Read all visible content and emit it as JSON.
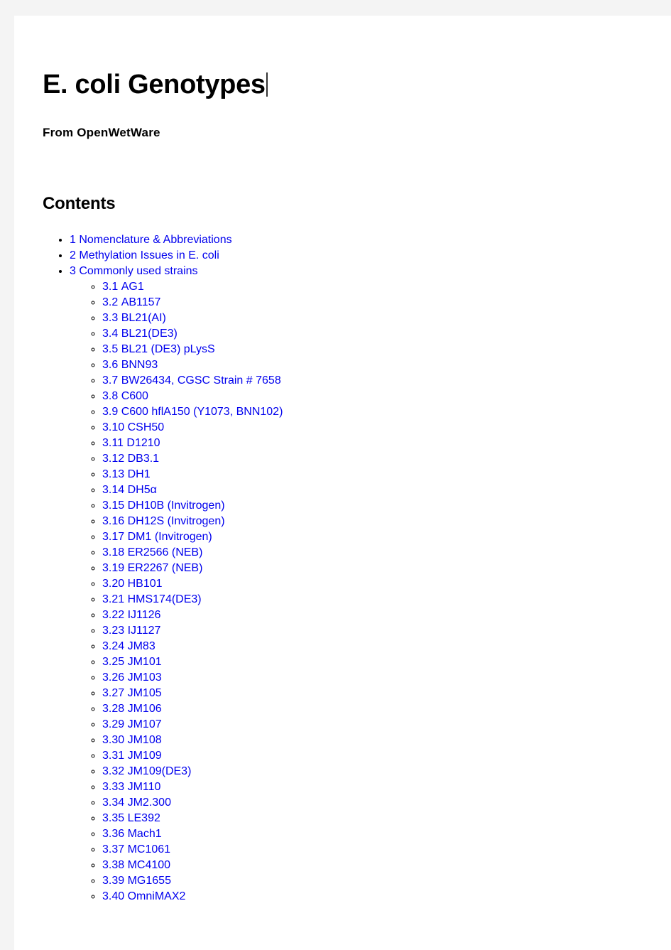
{
  "page": {
    "title": "E. coli Genotypes",
    "source_line": "From  OpenWetWare",
    "contents_heading": "Contents",
    "link_color": "#0000ee",
    "text_color": "#000000",
    "background_color": "#ffffff",
    "chrome_color": "#f4f4f4"
  },
  "toc": [
    {
      "number": "1",
      "label": "Nomenclature  &  Abbreviations",
      "children": []
    },
    {
      "number": "2",
      "label": "Methylation  Issues  in  E.  coli",
      "children": []
    },
    {
      "number": "3",
      "label": "Commonly  used  strains",
      "children": [
        {
          "number": "3.1",
          "label": "AG1"
        },
        {
          "number": "3.2",
          "label": "AB1157"
        },
        {
          "number": "3.3",
          "label": "BL21(AI)"
        },
        {
          "number": "3.4",
          "label": "BL21(DE3)"
        },
        {
          "number": "3.5",
          "label": "BL21  (DE3)  pLysS"
        },
        {
          "number": "3.6",
          "label": "BNN93"
        },
        {
          "number": "3.7",
          "label": "BW26434,  CGSC  Strain  #  7658"
        },
        {
          "number": "3.8",
          "label": "C600"
        },
        {
          "number": "3.9",
          "label": "C600  hflA150  (Y1073,  BNN102)"
        },
        {
          "number": "3.10",
          "label": "CSH50"
        },
        {
          "number": "3.11",
          "label": "D1210"
        },
        {
          "number": "3.12",
          "label": "DB3.1"
        },
        {
          "number": "3.13",
          "label": "DH1"
        },
        {
          "number": "3.14",
          "label": "DH5α"
        },
        {
          "number": "3.15",
          "label": "DH10B  (Invitrogen)"
        },
        {
          "number": "3.16",
          "label": "DH12S  (Invitrogen)"
        },
        {
          "number": "3.17",
          "label": "DM1  (Invitrogen)"
        },
        {
          "number": "3.18",
          "label": "ER2566  (NEB)"
        },
        {
          "number": "3.19",
          "label": "ER2267  (NEB)"
        },
        {
          "number": "3.20",
          "label": "HB101"
        },
        {
          "number": "3.21",
          "label": "HMS174(DE3)"
        },
        {
          "number": "3.22",
          "label": "IJ1126"
        },
        {
          "number": "3.23",
          "label": "IJ1127"
        },
        {
          "number": "3.24",
          "label": "JM83"
        },
        {
          "number": "3.25",
          "label": "JM101"
        },
        {
          "number": "3.26",
          "label": "JM103"
        },
        {
          "number": "3.27",
          "label": "JM105"
        },
        {
          "number": "3.28",
          "label": "JM106"
        },
        {
          "number": "3.29",
          "label": "JM107"
        },
        {
          "number": "3.30",
          "label": "JM108"
        },
        {
          "number": "3.31",
          "label": "JM109"
        },
        {
          "number": "3.32",
          "label": "JM109(DE3)"
        },
        {
          "number": "3.33",
          "label": "JM110"
        },
        {
          "number": "3.34",
          "label": "JM2.300"
        },
        {
          "number": "3.35",
          "label": "LE392"
        },
        {
          "number": "3.36",
          "label": "Mach1"
        },
        {
          "number": "3.37",
          "label": "MC1061"
        },
        {
          "number": "3.38",
          "label": "MC4100"
        },
        {
          "number": "3.39",
          "label": "MG1655"
        },
        {
          "number": "3.40",
          "label": "OmniMAX2"
        }
      ]
    }
  ]
}
